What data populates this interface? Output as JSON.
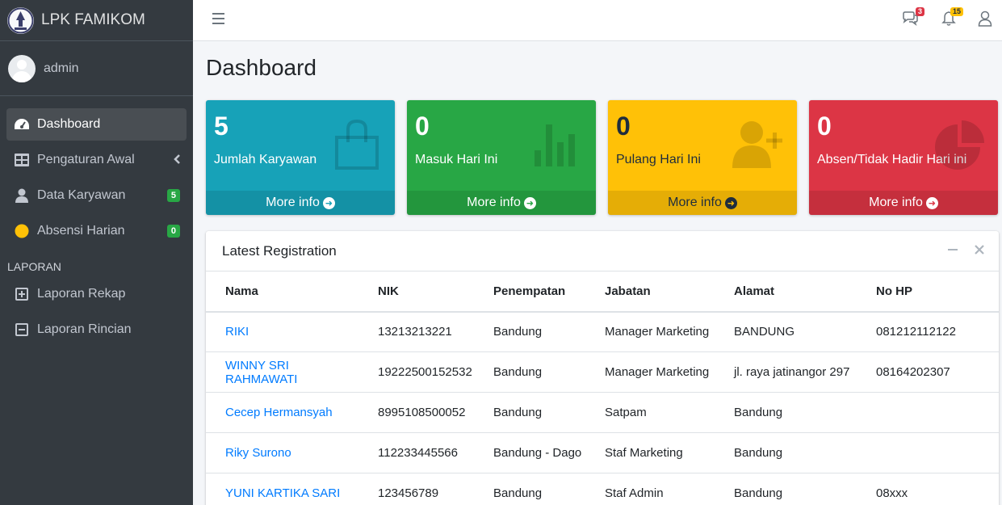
{
  "brand": {
    "name": "LPK FAMIKOM",
    "logo_text": "FAMIKOM"
  },
  "user": {
    "name": "admin"
  },
  "sidebar": {
    "items": [
      {
        "label": "Dashboard",
        "icon": "tachometer-icon",
        "active": true
      },
      {
        "label": "Pengaturan Awal",
        "icon": "grid-icon",
        "chevron": "<"
      },
      {
        "label": "Data Karyawan",
        "icon": "user-icon",
        "badge": "5"
      },
      {
        "label": "Absensi Harian",
        "icon": "circle-icon",
        "badge": "0"
      }
    ],
    "section_header": "LAPORAN",
    "report_items": [
      {
        "label": "Laporan Rekap",
        "icon": "plus-square-icon"
      },
      {
        "label": "Laporan Rincian",
        "icon": "minus-square-icon"
      }
    ]
  },
  "topbar": {
    "messages_badge": "3",
    "notifications_badge": "15"
  },
  "page": {
    "title": "Dashboard"
  },
  "stats": [
    {
      "value": "5",
      "label": "Jumlah Karyawan",
      "more": "More info",
      "color": "#17a2b8",
      "icon": "shopping-bag-icon"
    },
    {
      "value": "0",
      "label": "Masuk Hari Ini",
      "more": "More info",
      "color": "#28a745",
      "icon": "bar-chart-icon"
    },
    {
      "value": "0",
      "label": "Pulang Hari Ini",
      "more": "More info",
      "color": "#ffc107",
      "icon": "user-plus-icon"
    },
    {
      "value": "0",
      "label": "Absen/Tidak Hadir Hari ini",
      "more": "More info",
      "color": "#dc3545",
      "icon": "pie-chart-icon"
    }
  ],
  "registration": {
    "title": "Latest Registration",
    "columns": [
      "Nama",
      "NIK",
      "Penempatan",
      "Jabatan",
      "Alamat",
      "No HP"
    ],
    "rows": [
      [
        "RIKI",
        "13213213221",
        "Bandung",
        "Manager Marketing",
        "BANDUNG",
        "081212112122"
      ],
      [
        "WINNY SRI RAHMAWATI",
        "19222500152532",
        "Bandung",
        "Manager Marketing",
        "jl. raya jatinangor 297",
        "08164202307"
      ],
      [
        "Cecep Hermansyah",
        "8995108500052",
        "Bandung",
        "Satpam",
        "Bandung",
        ""
      ],
      [
        "Riky Surono",
        "112233445566",
        "Bandung - Dago",
        "Staf Marketing",
        "Bandung",
        ""
      ],
      [
        "YUNI KARTIKA SARI",
        "123456789",
        "Bandung",
        "Staf Admin",
        "Bandung",
        "08xxx"
      ]
    ]
  }
}
